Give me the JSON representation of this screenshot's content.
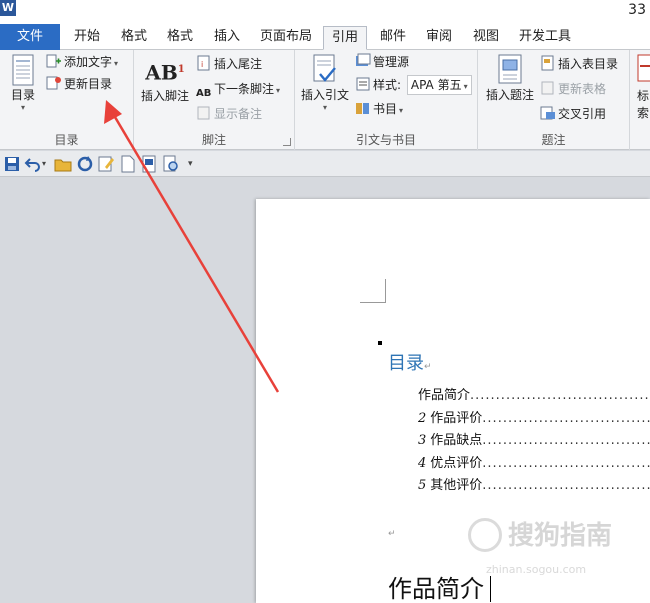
{
  "title_bar": {
    "app_icon": "W",
    "page_indicator": "33"
  },
  "tabs": [
    {
      "label": "文件"
    },
    {
      "label": "开始"
    },
    {
      "label": "格式"
    },
    {
      "label": "格式"
    },
    {
      "label": "插入"
    },
    {
      "label": "页面布局"
    },
    {
      "label": "引用"
    },
    {
      "label": "邮件"
    },
    {
      "label": "审阅"
    },
    {
      "label": "视图"
    },
    {
      "label": "开发工具"
    }
  ],
  "ribbon": {
    "toc_group": {
      "label": "目录",
      "toc_button": "目录",
      "add_text": "添加文字",
      "update_toc": "更新目录"
    },
    "footnote_group": {
      "label": "脚注",
      "insert_footnote": "插入脚注",
      "insert_endnote": "插入尾注",
      "next_footnote": "下一条脚注",
      "show_notes": "显示备注"
    },
    "citation_group": {
      "label": "引文与书目",
      "insert_citation": "插入引文",
      "manage_sources": "管理源",
      "style_label": "样式:",
      "style_value": "APA 第五",
      "bibliography": "书目"
    },
    "caption_group": {
      "label": "题注",
      "insert_caption": "插入题注",
      "insert_table_of_figures": "插入表目录",
      "update_table": "更新表格",
      "cross_reference": "交叉引用"
    },
    "index_group": {
      "mark_top": "标",
      "mark_bottom": "索"
    }
  },
  "document": {
    "toc_heading": "目录",
    "toc_entries": [
      {
        "num": "",
        "text": "作品简介"
      },
      {
        "num": "2",
        "text": "作品评价"
      },
      {
        "num": "3",
        "text": "作品缺点"
      },
      {
        "num": "4",
        "text": "优点评价"
      },
      {
        "num": "5",
        "text": "其他评价"
      }
    ],
    "body_heading": "作品简介"
  },
  "watermark": {
    "text": "搜狗指南",
    "sub": "zhinan.sogou.com"
  },
  "colors": {
    "accent": "#2b6cc4",
    "heading": "#2e74b5",
    "arrow": "#e8413a"
  }
}
